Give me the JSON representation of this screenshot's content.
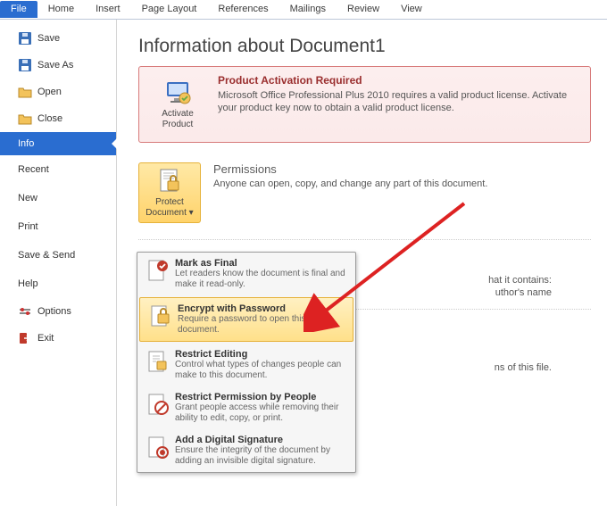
{
  "ribbon": {
    "tabs": [
      "File",
      "Home",
      "Insert",
      "Page Layout",
      "References",
      "Mailings",
      "Review",
      "View"
    ],
    "activeIndex": 0
  },
  "fileMenu": {
    "items": [
      {
        "label": "Save",
        "icon": "disk"
      },
      {
        "label": "Save As",
        "icon": "disk"
      },
      {
        "label": "Open",
        "icon": "folder"
      },
      {
        "label": "Close",
        "icon": "folder"
      }
    ],
    "info": "Info",
    "categories": [
      "Recent",
      "New",
      "Print",
      "Save & Send",
      "Help"
    ],
    "footer": [
      {
        "label": "Options",
        "icon": "options"
      },
      {
        "label": "Exit",
        "icon": "exit"
      }
    ]
  },
  "page": {
    "title": "Information about Document1",
    "activation": {
      "heading": "Product Activation Required",
      "body": "Microsoft Office Professional Plus 2010 requires a valid product license. Activate your product key now to obtain a valid product license.",
      "button": "Activate Product"
    },
    "permissions": {
      "heading": "Permissions",
      "body": "Anyone can open, copy, and change any part of this document.",
      "button": "Protect Document"
    },
    "partial1a": "hat it contains:",
    "partial1b": "uthor's name",
    "partial2": "ns of this file."
  },
  "dropdown": {
    "items": [
      {
        "title": "Mark as Final",
        "desc": "Let readers know the document is final and make it read-only.",
        "icon": "final"
      },
      {
        "title": "Encrypt with Password",
        "desc": "Require a password to open this document.",
        "icon": "lock",
        "hl": true
      },
      {
        "title": "Restrict Editing",
        "desc": "Control what types of changes people can make to this document.",
        "icon": "restrict"
      },
      {
        "title": "Restrict Permission by People",
        "desc": "Grant people access while removing their ability to edit, copy, or print.",
        "icon": "people"
      },
      {
        "title": "Add a Digital Signature",
        "desc": "Ensure the integrity of the document by adding an invisible digital signature.",
        "icon": "signature"
      }
    ]
  }
}
